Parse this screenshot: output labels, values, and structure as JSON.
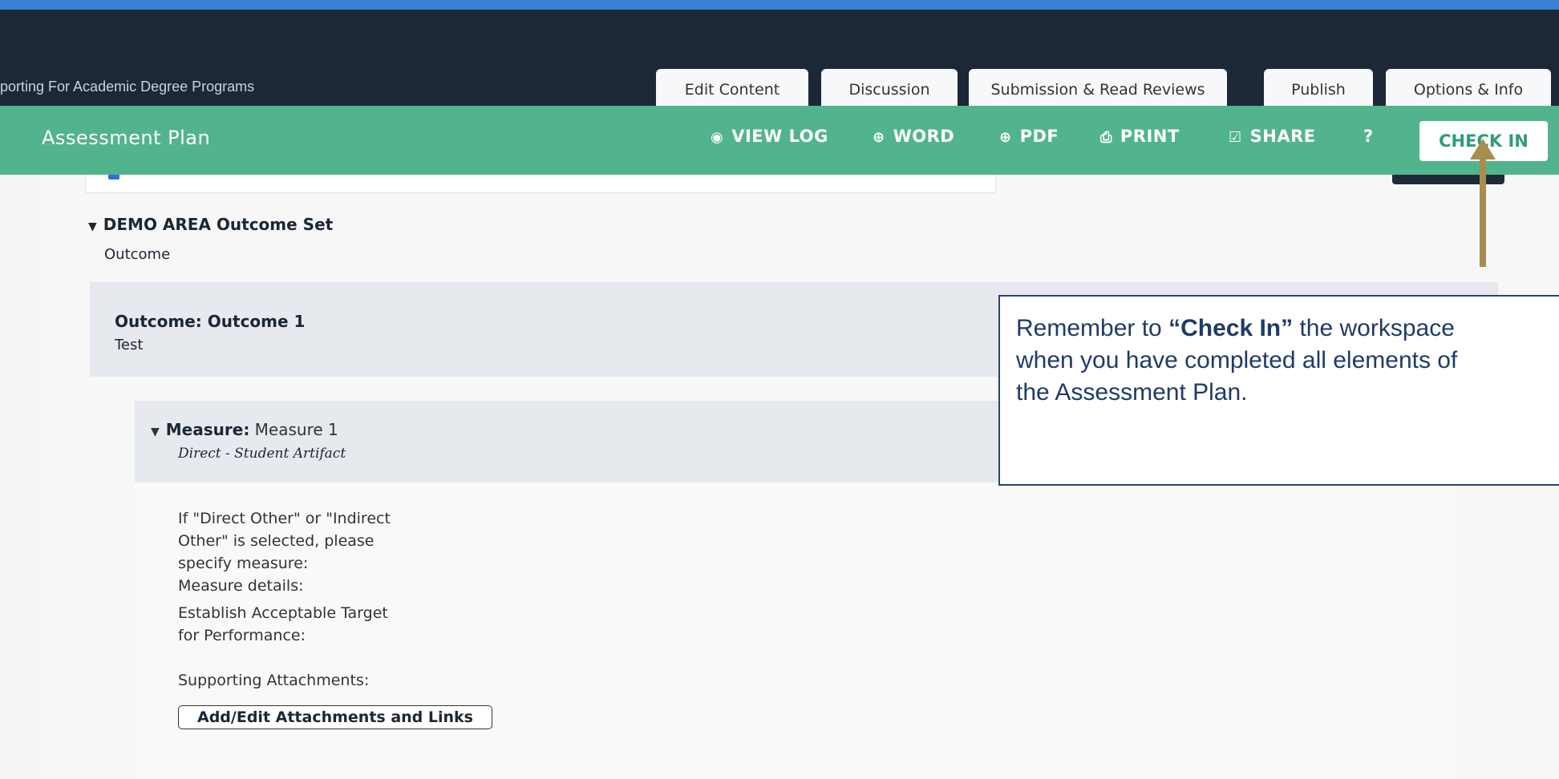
{
  "header": {
    "breadcrumb": "porting For Academic Degree Programs",
    "tabs": [
      {
        "label": "Edit Content"
      },
      {
        "label": "Discussion"
      },
      {
        "label": "Submission & Read Reviews"
      },
      {
        "label": "Publish"
      },
      {
        "label": "Options & Info"
      }
    ]
  },
  "toolbar": {
    "title": "Assessment Plan",
    "view_log": "VIEW LOG",
    "word": "WORD",
    "pdf": "PDF",
    "print": "PRINT",
    "share": "SHARE",
    "help": "?",
    "check_in": "CHECK IN",
    "icons": {
      "view_log": "eye-icon",
      "word": "download-icon",
      "pdf": "download-icon",
      "print": "printer-icon",
      "share": "checkbox-icon",
      "help": "help-icon"
    }
  },
  "outcome_set": {
    "title": "DEMO AREA Outcome Set",
    "subtitle": "Outcome"
  },
  "outcome": {
    "title": "Outcome: Outcome 1",
    "subtitle": "Test"
  },
  "measure": {
    "label": "Measure:",
    "name": "Measure 1",
    "type": "Direct - Student Artifact",
    "details": [
      "If \"Direct Other\" or \"Indirect",
      "Other\" is selected, please",
      "specify measure:",
      "Measure details:",
      "Establish Acceptable Target",
      "for Performance:"
    ],
    "attachments_label": "Supporting Attachments:",
    "attachments_button": "Add/Edit Attachments and Links"
  },
  "callout": {
    "prefix": "Remember to ",
    "emphasis": "“Check In”",
    "line1_rest": " the workspace",
    "line2": "when you have completed all elements of",
    "line3": "the Assessment Plan."
  },
  "colors": {
    "header": "#1c2838",
    "accent_green": "#52b48c",
    "callout_border": "#27446e",
    "arrow": "#a78d4e"
  }
}
